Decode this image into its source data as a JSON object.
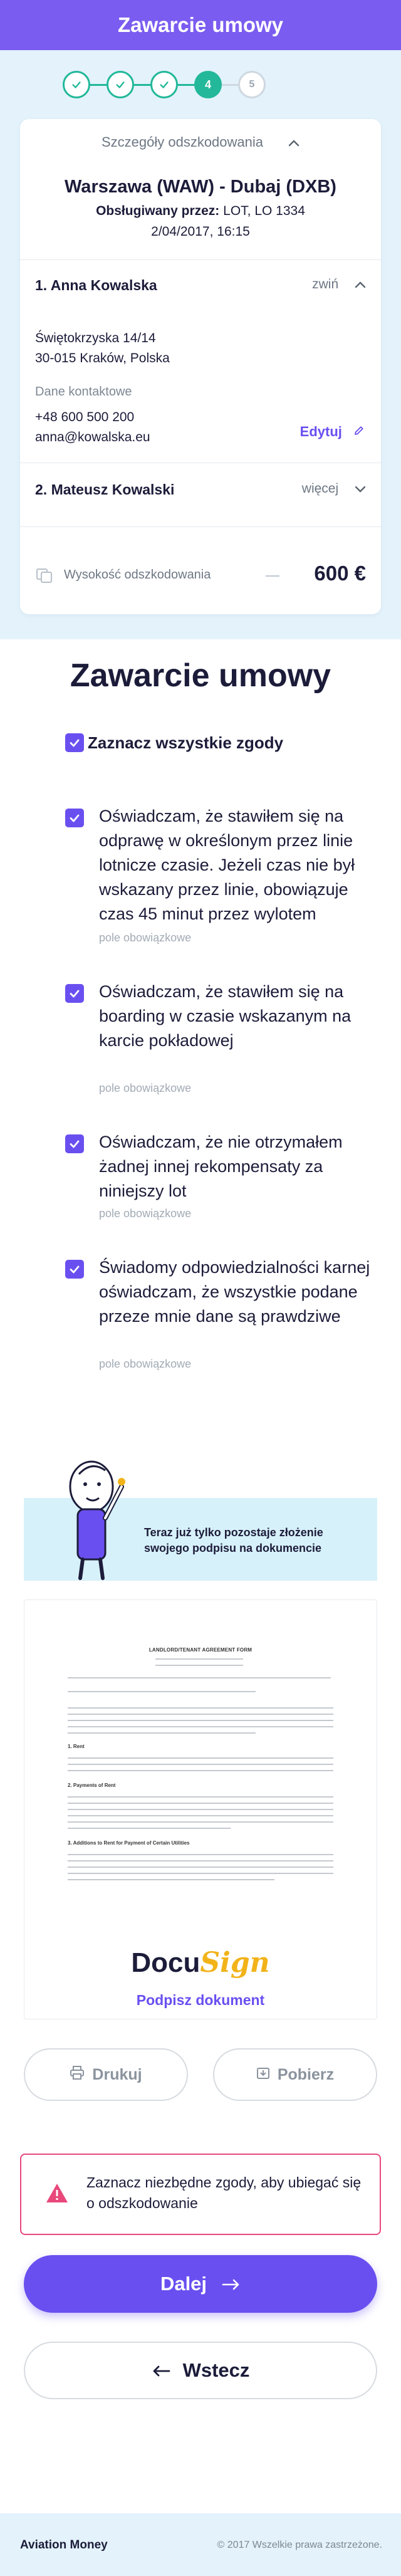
{
  "header": {
    "title": "Zawarcie umowy"
  },
  "steps": {
    "current": "4",
    "next": "5"
  },
  "summary": {
    "toggle_label": "Szczegóły odszkodowania",
    "route": "Warszawa (WAW) - Dubaj (DXB)",
    "operated_label": "Obsługiwany przez:",
    "operated_value": "LOT, LO 1334",
    "date": "2/04/2017, 16:15",
    "passenger1": {
      "name": "1. Anna Kowalska",
      "toggle": "zwiń",
      "address_line1": "Świętokrzyska 14/14",
      "address_line2": "30-015 Kraków, Polska",
      "contact_label": "Dane kontaktowe",
      "phone": "+48 600 500 200",
      "email": "anna@kowalska.eu",
      "edit_label": "Edytuj"
    },
    "passenger2": {
      "name": "2. Mateusz Kowalski",
      "toggle": "więcej"
    },
    "compensation_label": "Wysokość odszkodowania",
    "compensation_value": "600 €"
  },
  "consents": {
    "title": "Zawarcie umowy",
    "select_all": "Zaznacz wszystkie zgody",
    "items": [
      {
        "text": "Oświadczam, że stawiłem się na odprawę w określonym przez linie lotnicze czasie. Jeżeli czas nie był wskazany przez linie, obowiązuje czas 45 minut przez wylotem",
        "required": "pole obowiązkowe",
        "checked": true
      },
      {
        "text": "Oświadczam, że stawiłem się na boarding w czasie wskazanym na karcie pokładowej",
        "required": "pole obowiązkowe",
        "checked": true
      },
      {
        "text": "Oświadczam, że nie otrzymałem żadnej innej rekompensaty za niniejszy lot",
        "required": "pole obowiązkowe",
        "checked": true
      },
      {
        "text": "Świadomy odpowiedzialności karnej oświadczam, że wszystkie podane przeze mnie dane są prawdziwe",
        "required": "pole obowiązkowe",
        "checked": true
      }
    ]
  },
  "signature": {
    "banner_text": "Teraz już tylko pozostaje złożenie swojego podpisu na dokumencie",
    "doc_title": "LANDLORD/TENANT AGREEMENT FORM",
    "doc_headings": [
      "1. Rent",
      "2. Payments of Rent",
      "3. Additions to Rent for Payment of Certain Utilities"
    ],
    "brand_part1": "Docu",
    "brand_part2": "Sign",
    "sign_link": "Podpisz dokument"
  },
  "actions": {
    "print_label": "Drukuj",
    "download_label": "Pobierz",
    "alert_text": "Zaznacz niezbędne zgody, aby ubiegać się o odszkodowanie",
    "next_label": "Dalej",
    "back_label": "Wstecz"
  },
  "footer": {
    "brand": "Aviation Money",
    "copyright": "© 2017 Wszelkie prawa zastrzeżone."
  },
  "colors": {
    "primary": "#6a4ff0",
    "header": "#7b5cf0",
    "success": "#22b899",
    "danger": "#e8487a",
    "light_bg": "#e3f2fb"
  }
}
